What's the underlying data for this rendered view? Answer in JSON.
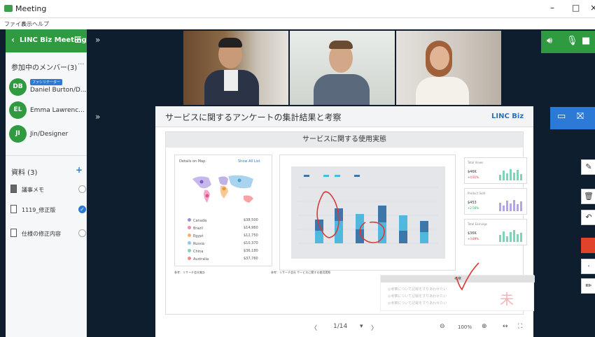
{
  "window": {
    "title": "Meeting",
    "minimize": "–",
    "maximize": "□",
    "close": "×"
  },
  "menu": [
    "ファイル",
    "表示",
    "ヘルプ"
  ],
  "sidebar": {
    "header": "LINC Biz Meeting",
    "members_title": "参加中のメンバー(3)",
    "more": "···",
    "members": [
      {
        "initials": "DB",
        "name": "Daniel Burton/D...",
        "badge": "ファシリテーター"
      },
      {
        "initials": "EL",
        "name": "Emma Lawrenc..."
      },
      {
        "initials": "JI",
        "name": "Jin/Designer"
      }
    ],
    "docs_title": "資料 (3)",
    "add": "+",
    "docs": [
      {
        "label": "議事メモ",
        "selected": false
      },
      {
        "label": "1119_修正版",
        "selected": true
      },
      {
        "label": "仕様の修正内容",
        "selected": false
      }
    ]
  },
  "controls": {
    "collapse_top": "»",
    "collapse_mid": "»",
    "speaker_icon": "speaker-icon",
    "mic_icon": "mic-icon",
    "camera_icon": "camera-icon",
    "window_icon": "window-icon",
    "share_off_icon": "share-off-icon"
  },
  "slide": {
    "title": "サービスに関するアンケートの集計結果と考察",
    "brand": "LINC Biz",
    "subtitle": "サービスに関する使用実態",
    "map_title": "Details on Map",
    "map_link": "Show All List",
    "countries": [
      {
        "name": "Canada",
        "value": "$38,500",
        "color": "#a28bd8"
      },
      {
        "name": "Brazil",
        "value": "$14,960",
        "color": "#f28ab0"
      },
      {
        "name": "Egypt",
        "value": "$12,750",
        "color": "#f4b26a"
      },
      {
        "name": "Russia",
        "value": "$10,370",
        "color": "#8fc8e8"
      },
      {
        "name": "China",
        "value": "$36,180",
        "color": "#7fd3b8"
      },
      {
        "name": "Australia",
        "value": "$37,760",
        "color": "#f08a8a"
      }
    ],
    "kpis": [
      {
        "title": "Total Views",
        "value": "$46K",
        "pct": "+4.91%",
        "pct_color": "#d33"
      },
      {
        "title": "Product Sold",
        "value": "$453",
        "pct": "+2.56%",
        "pct_color": "#2a9d4a"
      },
      {
        "title": "Total Earnings",
        "value": "$36K",
        "pct": "+3.89%",
        "pct_color": "#d33"
      }
    ],
    "caption_left": "参考：リサーチ会社集計",
    "caption_mid": "参考：リサーチ会社 サービスに関する使用実態",
    "note_header": "考察",
    "note_lines": [
      "◎考察について記録をすりあわせたい",
      "◎考察について記録をすりあわせたい",
      "◎考察について記録をすりあわせたい"
    ],
    "note_mark": "未",
    "colors": {
      "bar_dark": "#3d76a8",
      "bar_light": "#4fb8dc",
      "annotation": "#d83a3a"
    }
  },
  "footer": {
    "prev": "〈",
    "page": "1/14",
    "menu": "▾",
    "next": "〉",
    "zoom_out": "⊖",
    "zoom": "100%",
    "zoom_in": "⊕",
    "fit_width": "↔",
    "fullscreen": "⛶"
  },
  "tools": [
    "pen-select-icon",
    "trash-icon",
    "undo-icon",
    "color-swatch",
    "line-weight-icon",
    "pencil-icon"
  ],
  "tool_colors": {
    "swatch": "#e0432a"
  }
}
